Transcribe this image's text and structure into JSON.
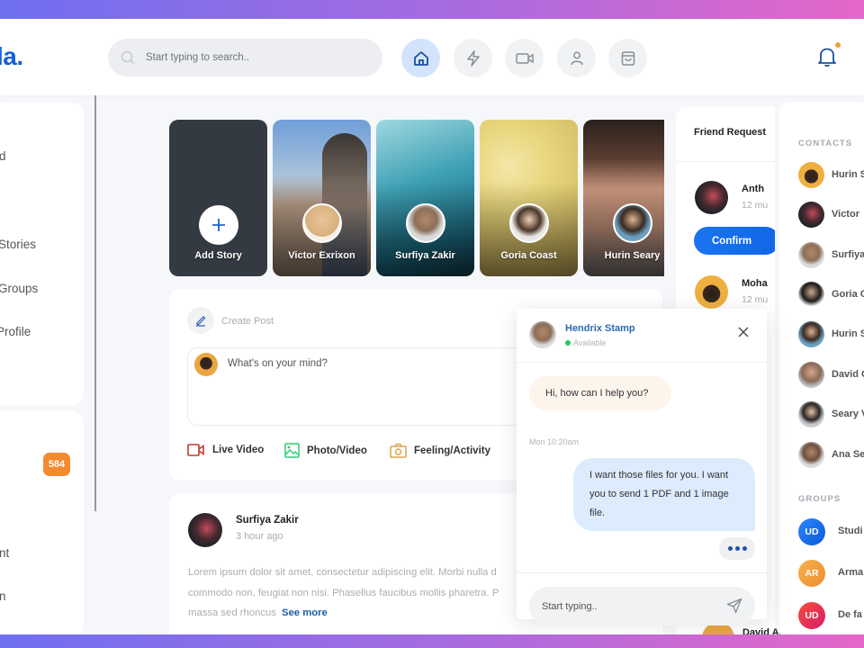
{
  "header": {
    "logo": "la.",
    "search_placeholder": "Start typing to search..",
    "nav": [
      {
        "icon": "home-icon",
        "active": true
      },
      {
        "icon": "lightning-icon",
        "active": false
      },
      {
        "icon": "video-icon",
        "active": false
      },
      {
        "icon": "user-icon",
        "active": false
      },
      {
        "icon": "shopping-bag-icon",
        "active": false
      }
    ],
    "notification_icon": "bell-icon"
  },
  "left_sidebar": {
    "items": [
      {
        "label": "d"
      },
      {
        "label": "Stories"
      },
      {
        "label": "Groups"
      },
      {
        "label": "Profile"
      }
    ],
    "secondary": [
      {
        "label": "",
        "badge": "584"
      },
      {
        "label": "nt"
      },
      {
        "label": "n"
      }
    ]
  },
  "stories": [
    {
      "name": "Add Story",
      "type": "add"
    },
    {
      "name": "Victor Exrixon"
    },
    {
      "name": "Surfiya Zakir"
    },
    {
      "name": "Goria Coast"
    },
    {
      "name": "Hurin Seary"
    }
  ],
  "create_post": {
    "title": "Create Post",
    "placeholder": "What's on your mind?",
    "actions": [
      {
        "label": "Live Video",
        "color": "#c0392b"
      },
      {
        "label": "Photo/Video",
        "color": "#2ecc71"
      },
      {
        "label": "Feeling/Activity",
        "color": "#e0a24a"
      }
    ]
  },
  "post": {
    "author": "Surfiya Zakir",
    "time": "3 hour ago",
    "text": "Lorem ipsum dolor sit amet, consectetur adipiscing elit. Morbi nulla d commodo non, feugiat non nisi. Phasellus faucibus mollis pharetra. P massa sed rhoncus",
    "see_more": "See more"
  },
  "friend_requests": {
    "title": "Friend Request",
    "items": [
      {
        "name": "Anth",
        "time": "12 mu"
      },
      {
        "name": "Moha",
        "time": "12 mu"
      }
    ],
    "confirm_label": "Confirm",
    "bottom_name": "David Agfree"
  },
  "contacts": {
    "label": "CONTACTS",
    "items": [
      {
        "name": "Hurin S"
      },
      {
        "name": "Victor"
      },
      {
        "name": "Surfiya"
      },
      {
        "name": "Goria C"
      },
      {
        "name": "Hurin S"
      },
      {
        "name": "David C"
      },
      {
        "name": "Seary V"
      },
      {
        "name": "Ana Se"
      }
    ]
  },
  "groups": {
    "label": "GROUPS",
    "items": [
      {
        "initials": "UD",
        "name": "Studi",
        "color": "#1a6ff0"
      },
      {
        "initials": "AR",
        "name": "Arma",
        "color": "#f0a23c"
      },
      {
        "initials": "UD",
        "name": "De fa",
        "color": "#e8245c"
      }
    ]
  },
  "chat": {
    "name": "Hendrix Stamp",
    "status": "Available",
    "messages": [
      {
        "from": "them",
        "text": "Hi, how can I help you?"
      },
      {
        "from": "me",
        "text": "I want those files for you. I want you to send 1 PDF and 1 image file."
      }
    ],
    "timestamp": "Mon 10:20am",
    "input_placeholder": "Start typing.."
  },
  "colors": {
    "brand": "#1560d8",
    "badge": "#f48a2f",
    "confirm": "#1b74f0",
    "online": "#22c55e"
  }
}
